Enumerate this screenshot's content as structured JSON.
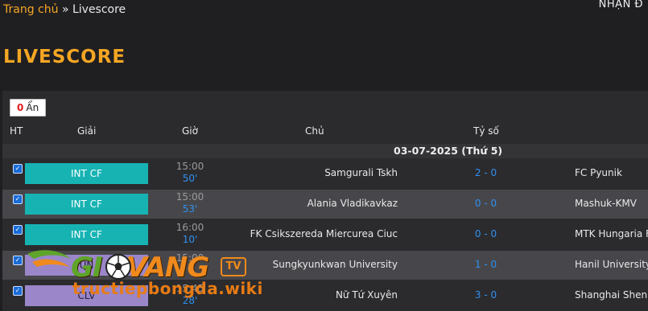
{
  "breadcrumb": {
    "home": "Trang chủ",
    "separator": "»",
    "current": "Livescore"
  },
  "topright_text": "NHẬN Đ",
  "page_title": "LIVESCORE",
  "hide_button": {
    "count": "0",
    "label": "Ẩn"
  },
  "table": {
    "headers": {
      "ht": "HT",
      "league": "Giải",
      "time": "Giờ",
      "home": "Chủ",
      "score": "Tỷ số"
    },
    "date_label": "03-07-2025 (Thứ 5)",
    "rows": [
      {
        "league": "INT CF",
        "kickoff": "15:00",
        "minute": "50'",
        "home": "Samgurali Tskh",
        "score": "2 - 0",
        "away": "FC Pyunik"
      },
      {
        "league": "INT CF",
        "kickoff": "15:00",
        "minute": "53'",
        "home": "Alania Vladikavkaz",
        "score": "0 - 0",
        "away": "Mashuk-KMV"
      },
      {
        "league": "INT CF",
        "kickoff": "16:00",
        "minute": "10'",
        "home": "FK Csikszereda Miercurea Ciuc",
        "score": "0 - 0",
        "away": "MTK Hungaria F"
      },
      {
        "league": "UN",
        "kickoff": "15:00",
        "minute": "",
        "home": "Sungkyunkwan University",
        "score": "1 - 0",
        "away": "Hanil University"
      },
      {
        "league": "CLV",
        "kickoff": "15:45",
        "minute": "28'",
        "home": "Nữ Tứ Xuyên",
        "score": "3 - 0",
        "away": "Shanghai Shenh"
      }
    ]
  },
  "watermark": {
    "brand_g": "GI",
    "brand_rest": "VANG",
    "tv": "TV",
    "site": "tructiepbongda.wiki"
  },
  "colors": {
    "accent": "#f5a623",
    "league_teal": "#17b3b3",
    "score_blue": "#2f90f0"
  }
}
